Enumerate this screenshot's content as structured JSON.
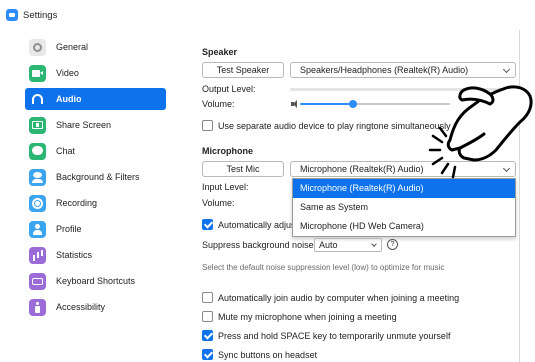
{
  "window": {
    "title": "Settings"
  },
  "sidebar": {
    "items": [
      {
        "label": "General",
        "icon": "gear-icon"
      },
      {
        "label": "Video",
        "icon": "video-camera-icon"
      },
      {
        "label": "Audio",
        "icon": "headphones-icon",
        "active": true
      },
      {
        "label": "Share Screen",
        "icon": "share-screen-icon"
      },
      {
        "label": "Chat",
        "icon": "chat-bubble-icon"
      },
      {
        "label": "Background & Filters",
        "icon": "person-background-icon"
      },
      {
        "label": "Recording",
        "icon": "record-icon"
      },
      {
        "label": "Profile",
        "icon": "profile-icon"
      },
      {
        "label": "Statistics",
        "icon": "bar-chart-icon"
      },
      {
        "label": "Keyboard Shortcuts",
        "icon": "keyboard-icon"
      },
      {
        "label": "Accessibility",
        "icon": "accessibility-icon"
      }
    ]
  },
  "speaker": {
    "title": "Speaker",
    "test_button": "Test Speaker",
    "device": "Speakers/Headphones (Realtek(R) Audio)",
    "output_level_label": "Output Level:",
    "volume_label": "Volume:",
    "volume_value": 0.35,
    "separate_device_label": "Use separate audio device to play ringtone simultaneously",
    "separate_device_checked": false
  },
  "microphone": {
    "title": "Microphone",
    "test_button": "Test Mic",
    "device": "Microphone (Realtek(R) Audio)",
    "input_level_label": "Input Level:",
    "volume_label": "Volume:",
    "auto_adjust_label": "Automatically adjus",
    "auto_adjust_checked": true,
    "dropdown_options": [
      "Microphone (Realtek(R) Audio)",
      "Same as System",
      "Microphone (HD Web Camera)"
    ],
    "dropdown_selected_index": 0
  },
  "noise": {
    "label": "Suppress background noise",
    "value": "Auto",
    "help_glyph": "?",
    "hint": "Select the default noise suppression level (low) to optimize for music"
  },
  "options": [
    {
      "label": "Automatically join audio by computer when joining a meeting",
      "checked": false
    },
    {
      "label": "Mute my microphone when joining a meeting",
      "checked": false
    },
    {
      "label": "Press and hold SPACE key to temporarily unmute yourself",
      "checked": true
    },
    {
      "label": "Sync buttons on headset",
      "checked": true
    }
  ],
  "colors": {
    "accent": "#0e72ed",
    "slider": "#2d8cff"
  }
}
